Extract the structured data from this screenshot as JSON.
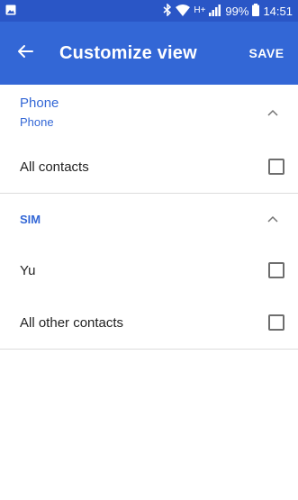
{
  "status_bar": {
    "battery": "99%",
    "time": "14:51",
    "network": "H+",
    "icons": [
      "image-icon",
      "bluetooth-icon",
      "wifi-icon",
      "signal-icon",
      "battery-icon"
    ]
  },
  "app_bar": {
    "title": "Customize view",
    "save_label": "SAVE",
    "background": "#3367d6"
  },
  "groups": [
    {
      "title": "Phone",
      "subtitle": "Phone",
      "items": [
        {
          "label": "All contacts",
          "checked": false
        }
      ]
    },
    {
      "title": "SIM",
      "items": [
        {
          "label": "Yu",
          "checked": false
        },
        {
          "label": "All other contacts",
          "checked": false
        }
      ]
    }
  ]
}
